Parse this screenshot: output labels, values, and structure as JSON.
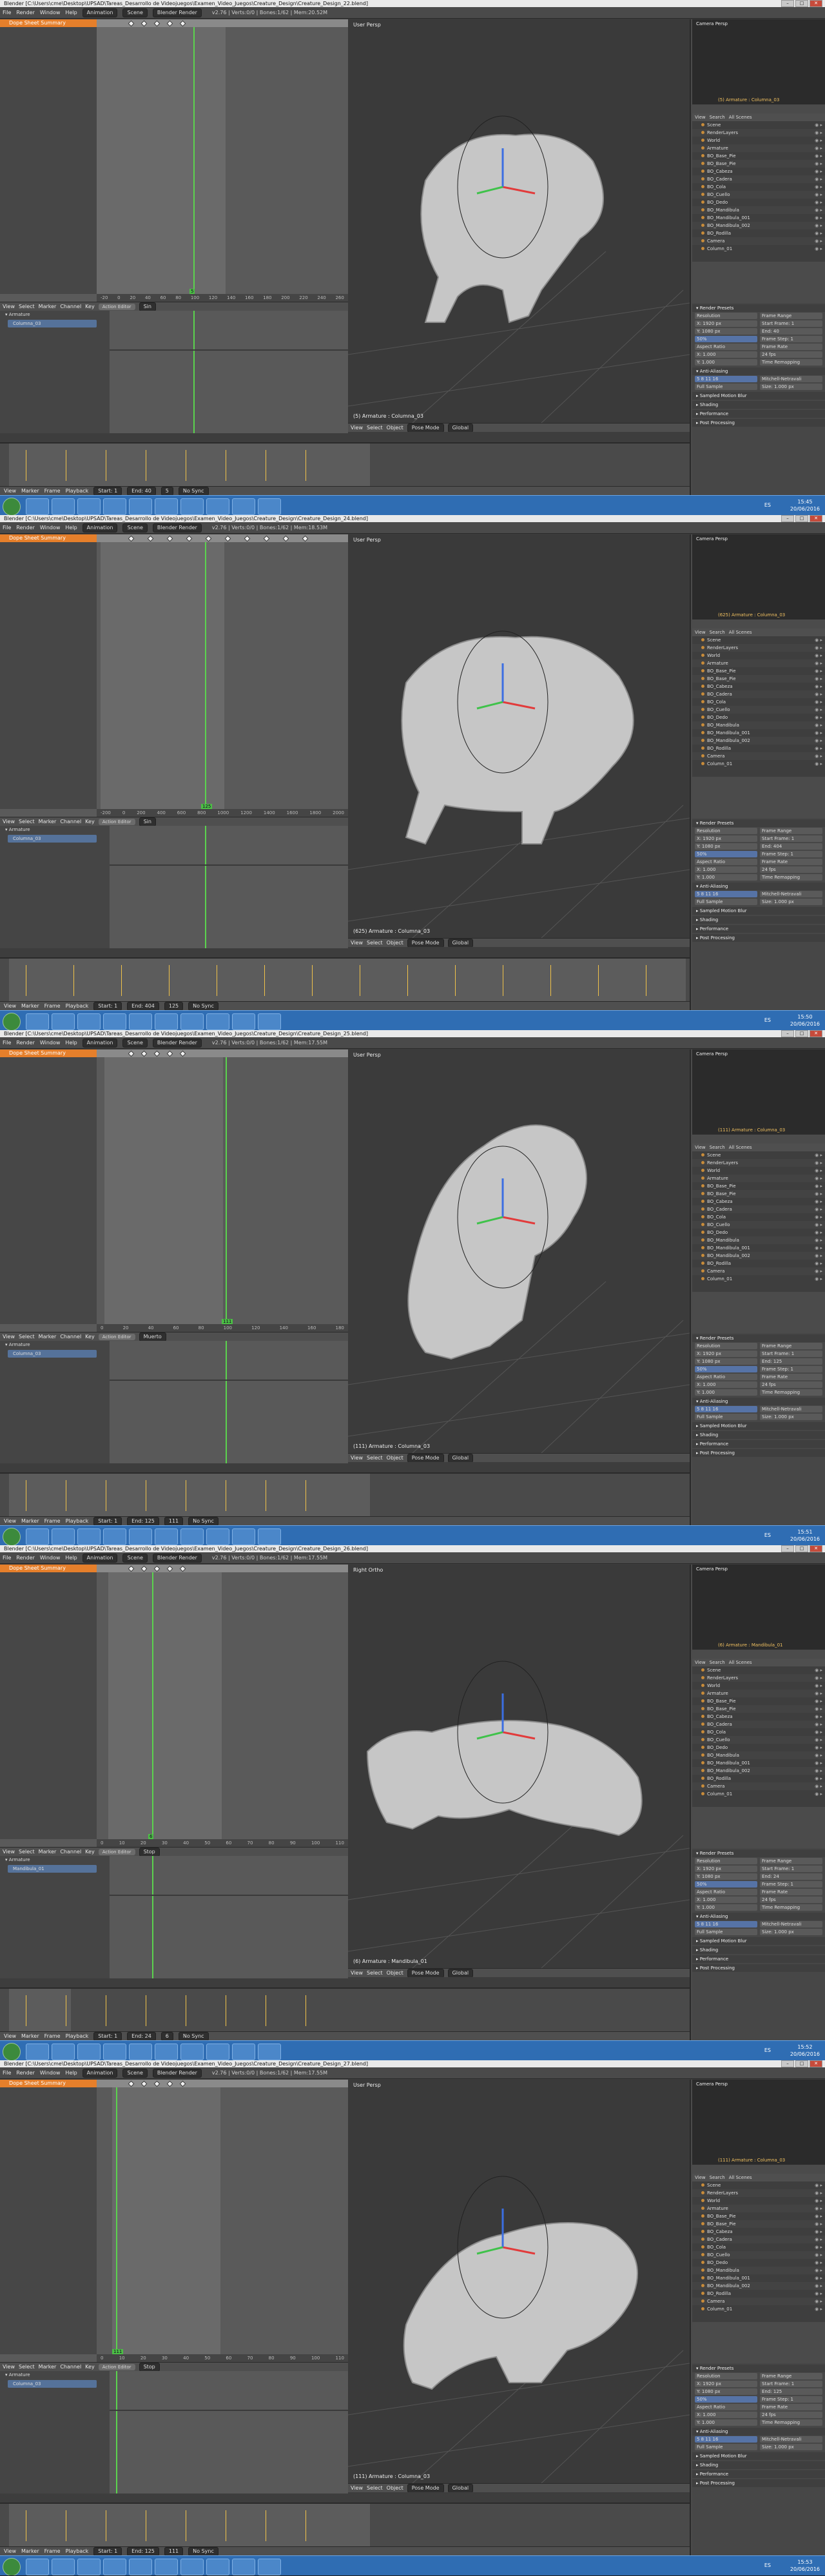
{
  "app": {
    "title_prefix": "Blender",
    "path": "[C:\\Users\\cme\\Desktop\\UPSAD\\Tareas_Desarrollo de Videojuegos\\Examen_Video_Juegos\\Creature_Design\\Creature_Design_",
    "menus": [
      "File",
      "Render",
      "Window",
      "Help"
    ],
    "render_engine": "Blender Render",
    "scene": "Scene",
    "layout": "Animation"
  },
  "common": {
    "summary_label": "Dope Sheet Summary",
    "armature_label": "Armature",
    "action_editor_label": "Action Editor",
    "fcurve": "F-Curve",
    "view_label": "View",
    "select_label": "Select",
    "marker_label": "Marker",
    "channel_label": "Channel",
    "key_label": "Key",
    "object_label": "Object",
    "pose_mode": "Pose Mode",
    "global_label": "Global",
    "frame_label": "Frame",
    "playback_label": "Playback",
    "start_label": "Start:",
    "end_label": "End:",
    "start_val": "1",
    "no_sync": "No Sync",
    "camera_persp": "Camera Persp",
    "outliner_view": "View",
    "outliner_search": "Search",
    "all_scenes": "All Scenes",
    "render_presets": "Render Presets",
    "anti_aliasing": "Anti-Aliasing",
    "sampled_motion_blur": "Sampled Motion Blur",
    "shading": "Shading",
    "performance": "Performance",
    "post_processing": "Post Processing",
    "mitchell": "Mitchell-Netravali",
    "full_sample": "Full Sample",
    "resolution": "Resolution",
    "frame_range": "Frame Range",
    "aspect_ratio": "Aspect Ratio",
    "frame_rate": "Frame Rate",
    "res_x": "X: 1920 px",
    "res_y": "Y: 1080 px",
    "res_pct": "50%",
    "start_frame": "Start Frame: 1",
    "frame_step": "Frame Step: 1",
    "fps": "24 fps",
    "asp_x": "X: 1.000",
    "asp_y": "Y: 1.000",
    "time_remap": "Time Remapping",
    "size_label": "Size: 1.000 px",
    "lang": "ES",
    "date": "20/06/2016"
  },
  "outliner_items": [
    "Scene",
    "RenderLayers",
    "World",
    "Armature",
    "BO_Base_Pie",
    "BO_Base_Pie",
    "BO_Cabeza",
    "BO_Cadera",
    "BO_Cola",
    "BO_Cuello",
    "BO_Dedo",
    "BO_Mandibula",
    "BO_Mandibula_001",
    "BO_Mandibula_002",
    "BO_Rodilla",
    "Camera",
    "Column_01"
  ],
  "shots": [
    {
      "file_num": "22",
      "stats": "v2.76 | Verts:0/0 | Bones:1/62 | Mem:20.52M",
      "action": "Sin",
      "action_channel": "Columna_03",
      "frame": "5",
      "end": "40",
      "viewport_title": "User Persp",
      "viewport_foot": "(5) Armature : Columna_03",
      "camera_foot": "(5) Armature : Columna_03",
      "clock": "15:45",
      "ruler": [
        "-20",
        "0",
        "20",
        "40",
        "60",
        "80",
        "100",
        "120",
        "140",
        "160",
        "180",
        "200",
        "220",
        "240",
        "260"
      ],
      "timeline_ruler": [
        "0",
        "20",
        "40",
        "60",
        "80",
        "100",
        "120",
        "140",
        "160",
        "180",
        "200",
        "220",
        "240",
        "260",
        "280"
      ]
    },
    {
      "file_num": "24",
      "stats": "v2.76 | Verts:0/0 | Bones:1/62 | Mem:18.53M",
      "action": "Sin",
      "action_channel": "Columna_03",
      "frame": "125",
      "end": "404",
      "viewport_title": "User Persp",
      "viewport_foot": "(625) Armature : Columna_03",
      "camera_foot": "(625) Armature : Columna_03",
      "clock": "15:50",
      "ruler": [
        "-200",
        "0",
        "200",
        "400",
        "600",
        "800",
        "1000",
        "1200",
        "1400",
        "1600",
        "1800",
        "2000"
      ],
      "timeline_ruler": [
        "0",
        "100",
        "200",
        "300",
        "400",
        "500",
        "600",
        "700",
        "800",
        "900",
        "1000",
        "1100",
        "1200"
      ]
    },
    {
      "file_num": "25",
      "stats": "v2.76 | Verts:0/0 | Bones:1/62 | Mem:17.55M",
      "action": "Muerto",
      "action_channel": "Columna_03",
      "frame": "111",
      "end": "125",
      "viewport_title": "User Persp",
      "viewport_foot": "(111) Armature : Columna_03",
      "camera_foot": "(111) Armature : Columna_03",
      "clock": "15:51",
      "ruler": [
        "0",
        "20",
        "40",
        "60",
        "80",
        "100",
        "120",
        "140",
        "160",
        "180"
      ],
      "timeline_ruler": [
        "0",
        "20",
        "40",
        "60",
        "80",
        "100",
        "120",
        "140",
        "160",
        "180",
        "200",
        "220",
        "240"
      ]
    },
    {
      "file_num": "26",
      "stats": "v2.76 | Verts:0/0 | Bones:1/62 | Mem:17.55M",
      "action": "Stop",
      "action_channel": "Mandibula_01",
      "frame": "6",
      "end": "24",
      "viewport_title": "Right Ortho",
      "viewport_foot": "(6) Armature : Mandibula_01",
      "camera_foot": "(6) Armature : Mandibula_01",
      "clock": "15:52",
      "ruler": [
        "0",
        "10",
        "20",
        "30",
        "40",
        "50",
        "60",
        "70",
        "80",
        "90",
        "100",
        "110"
      ],
      "timeline_ruler": [
        "0",
        "20",
        "40",
        "60",
        "80",
        "100",
        "120",
        "140",
        "160",
        "180",
        "200",
        "220",
        "240"
      ]
    },
    {
      "file_num": "27",
      "stats": "v2.76 | Verts:0/0 | Bones:1/62 | Mem:17.55M",
      "action": "Stop",
      "action_channel": "Columna_03",
      "frame": "111",
      "end": "125",
      "viewport_title": "User Persp",
      "viewport_foot": "(111) Armature : Columna_03",
      "camera_foot": "(111) Armature : Columna_03",
      "clock": "15:53",
      "ruler": [
        "0",
        "10",
        "20",
        "30",
        "40",
        "50",
        "60",
        "70",
        "80",
        "90",
        "100",
        "110"
      ],
      "timeline_ruler": [
        "0",
        "20",
        "40",
        "60",
        "80",
        "100",
        "120",
        "140",
        "160",
        "180",
        "200",
        "220",
        "240"
      ]
    }
  ],
  "colors": {
    "accent_orange": "#e57f2b",
    "cursor_green": "#5bd34e",
    "selection_blue": "#55729a",
    "taskbar_blue": "#2f6db3",
    "keyframe_yellow": "#f0c24a"
  }
}
